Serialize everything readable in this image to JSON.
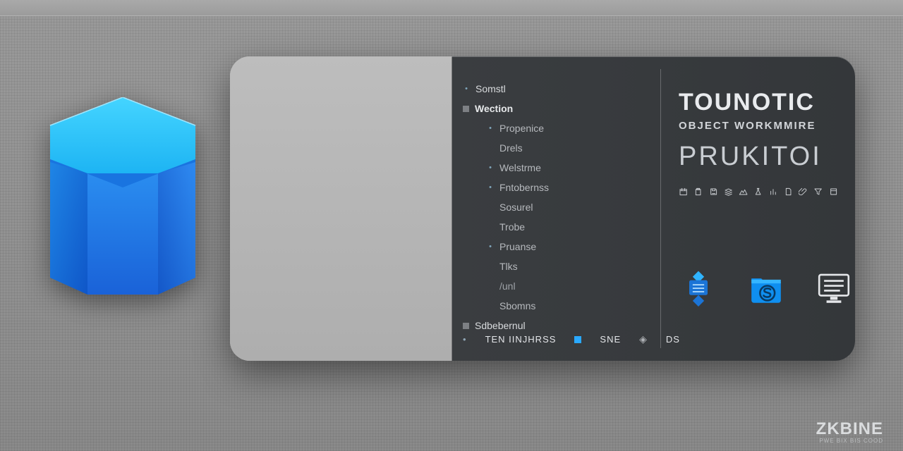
{
  "nav": {
    "items": [
      {
        "label": "Somstl",
        "kind": "dot"
      },
      {
        "label": "Wection",
        "kind": "sq",
        "selected": true
      },
      {
        "label": "Propenice",
        "kind": "sub-dot"
      },
      {
        "label": "Drels",
        "kind": "sub"
      },
      {
        "label": "Welstrme",
        "kind": "sub-dot"
      },
      {
        "label": "Fntobernss",
        "kind": "sub-dot"
      },
      {
        "label": "Sosurel",
        "kind": "sub"
      },
      {
        "label": "Trobe",
        "kind": "sub"
      },
      {
        "label": "Pruanse",
        "kind": "sub-dot"
      },
      {
        "label": "Tlks",
        "kind": "sub"
      },
      {
        "label": "/unl",
        "kind": "sub-muted"
      },
      {
        "label": "Sbomns",
        "kind": "sub"
      },
      {
        "label": "Sdbebernul",
        "kind": "sq"
      }
    ],
    "bottom": {
      "label1": "TEN IINJHRSS",
      "label2": "SNE",
      "label3": "DS"
    }
  },
  "brand": {
    "title": "TOUNOTIC",
    "subtitle": "OBJECT WORKMMIRE",
    "word": "PRUKITOI",
    "mini_icons": [
      "calendar",
      "clipboard",
      "save",
      "stack",
      "mountain",
      "flask",
      "chart",
      "file",
      "clip",
      "filter",
      "note"
    ]
  },
  "corner": {
    "logo": "ZKBINE",
    "tag": "PWE BIX BIS COOD"
  }
}
